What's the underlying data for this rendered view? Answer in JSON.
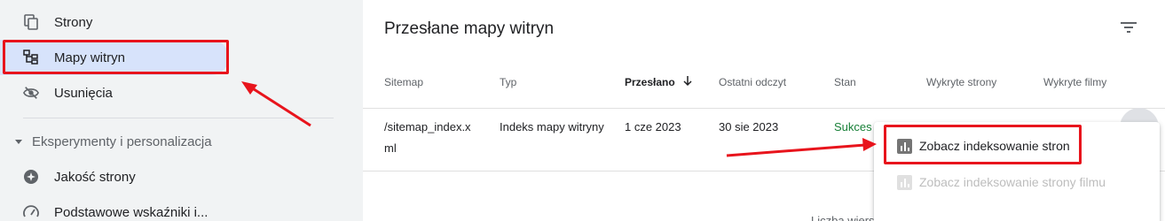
{
  "sidebar": {
    "items": [
      {
        "label": "Strony",
        "icon": "pages-icon"
      },
      {
        "label": "Mapy witryn",
        "icon": "sitemap-icon",
        "active": true
      },
      {
        "label": "Usunięcia",
        "icon": "eye-off-icon"
      }
    ],
    "section": {
      "label": "Eksperymenty i personalizacja"
    },
    "section_items": [
      {
        "label": "Jakość strony",
        "icon": "page-quality-icon"
      },
      {
        "label": "Podstawowe wskaźniki i...",
        "icon": "gauge-icon"
      }
    ]
  },
  "main": {
    "title": "Przesłane mapy witryn",
    "columns": [
      "Sitemap",
      "Typ",
      "Przesłano",
      "Ostatni odczyt",
      "Stan",
      "Wykryte strony",
      "Wykryte filmy"
    ],
    "sorted_column": "Przesłano",
    "rows": [
      {
        "sitemap_line1": "/sitemap_index.x",
        "sitemap_line2": "ml",
        "type": "Indeks mapy witryny",
        "submitted": "1 cze 2023",
        "last_read": "30 sie 2023",
        "status": "Sukces"
      }
    ],
    "footer_text": "Liczba wiersz"
  },
  "menu": {
    "items": [
      {
        "label": "Zobacz indeksowanie stron",
        "enabled": true
      },
      {
        "label": "Zobacz indeksowanie strony filmu",
        "enabled": false
      }
    ]
  },
  "colors": {
    "highlight": "#e8141c",
    "active_nav": "#d7e3fb",
    "success": "#188038"
  }
}
